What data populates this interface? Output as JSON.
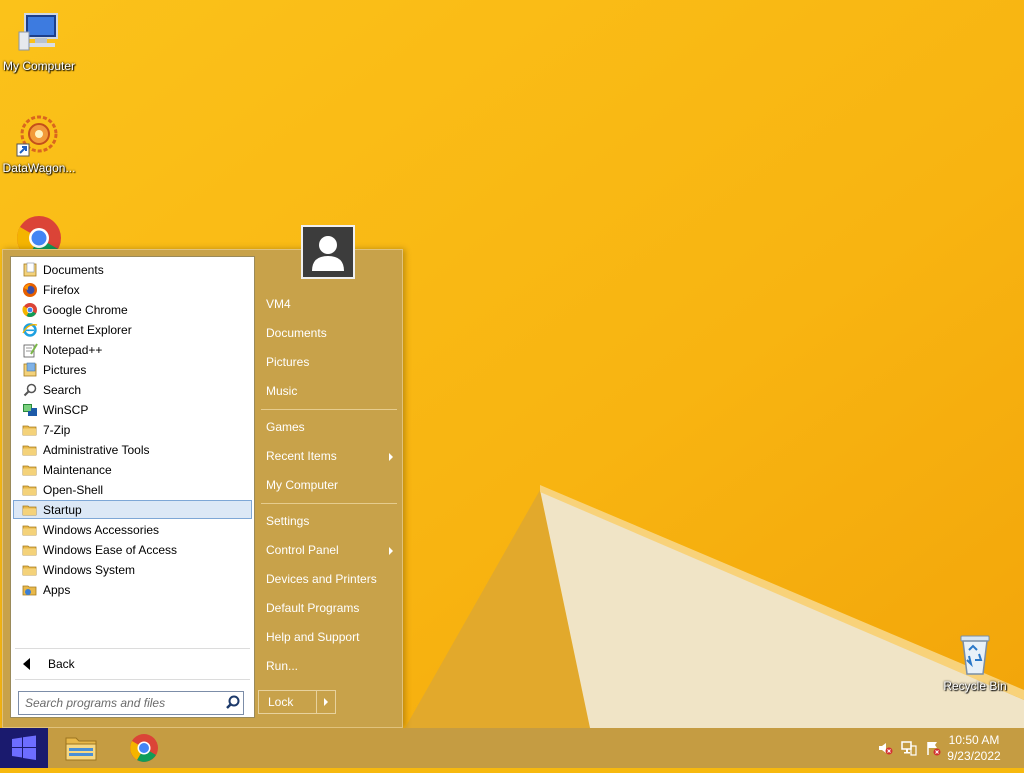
{
  "desktop": {
    "icons": [
      {
        "label": "My Computer"
      },
      {
        "label": "DataWagon..."
      },
      {
        "label": ""
      },
      {
        "label": "Recycle Bin"
      }
    ]
  },
  "start_menu": {
    "programs": [
      {
        "label": "Documents",
        "icon": "folder-docs-icon"
      },
      {
        "label": "Firefox",
        "icon": "firefox-icon"
      },
      {
        "label": "Google Chrome",
        "icon": "chrome-icon"
      },
      {
        "label": "Internet Explorer",
        "icon": "ie-icon"
      },
      {
        "label": "Notepad++",
        "icon": "notepadpp-icon"
      },
      {
        "label": "Pictures",
        "icon": "folder-pictures-icon"
      },
      {
        "label": "Search",
        "icon": "search-icon"
      },
      {
        "label": "WinSCP",
        "icon": "winscp-icon"
      },
      {
        "label": "7-Zip",
        "icon": "folder-icon"
      },
      {
        "label": "Administrative Tools",
        "icon": "folder-icon"
      },
      {
        "label": "Maintenance",
        "icon": "folder-icon"
      },
      {
        "label": "Open-Shell",
        "icon": "folder-icon"
      },
      {
        "label": "Startup",
        "icon": "folder-icon",
        "selected": true
      },
      {
        "label": "Windows Accessories",
        "icon": "folder-icon"
      },
      {
        "label": "Windows Ease of Access",
        "icon": "folder-icon"
      },
      {
        "label": "Windows System",
        "icon": "folder-icon"
      },
      {
        "label": "Apps",
        "icon": "apps-folder-icon"
      }
    ],
    "back_label": "Back",
    "search_placeholder": "Search programs and files",
    "right": {
      "username": "VM4",
      "documents": "Documents",
      "pictures": "Pictures",
      "music": "Music",
      "games": "Games",
      "recent_items": "Recent Items",
      "my_computer": "My Computer",
      "settings": "Settings",
      "control_panel": "Control Panel",
      "devices_printers": "Devices and Printers",
      "default_programs": "Default Programs",
      "help_support": "Help and Support",
      "run": "Run..."
    },
    "lock_label": "Lock"
  },
  "taskbar": {
    "time": "10:50 AM",
    "date": "9/23/2022"
  },
  "colors": {
    "wallpaper": "#f7b90e",
    "menu_bg": "#c8a24a",
    "taskbar": "#c59c42",
    "selection": "#dce8f6"
  }
}
